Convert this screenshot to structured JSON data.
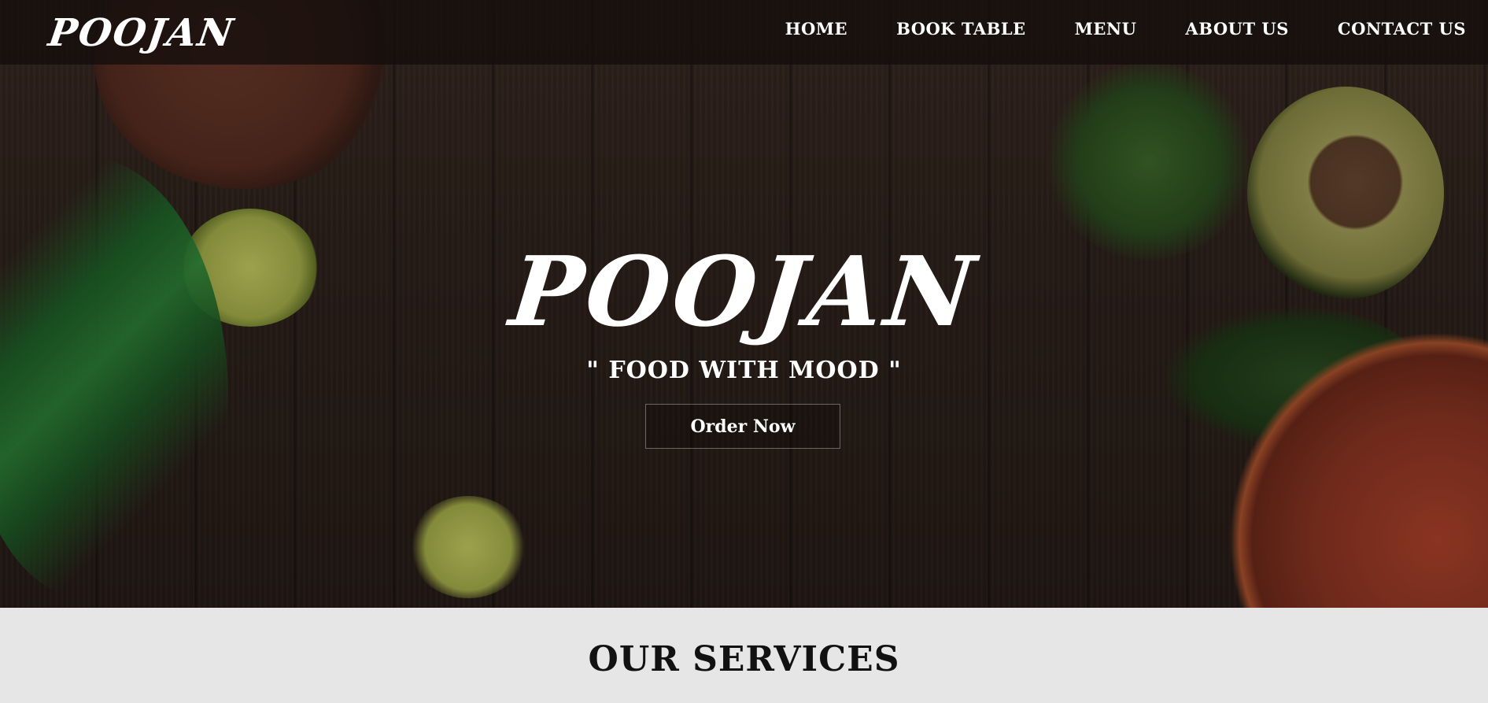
{
  "nav": {
    "logo": "POOJAN",
    "items": [
      {
        "label": "HOME"
      },
      {
        "label": "BOOK TABLE"
      },
      {
        "label": "MENU"
      },
      {
        "label": "ABOUT US"
      },
      {
        "label": "CONTACT US"
      }
    ]
  },
  "hero": {
    "title": "POOJAN",
    "tagline": "\" FOOD WITH MOOD \"",
    "cta_label": "Order Now"
  },
  "services": {
    "heading": "OUR SERVICES"
  },
  "colors": {
    "nav_bg": "#140e0c",
    "section_bg": "#e6e6e6",
    "wood": "#2f221c"
  }
}
